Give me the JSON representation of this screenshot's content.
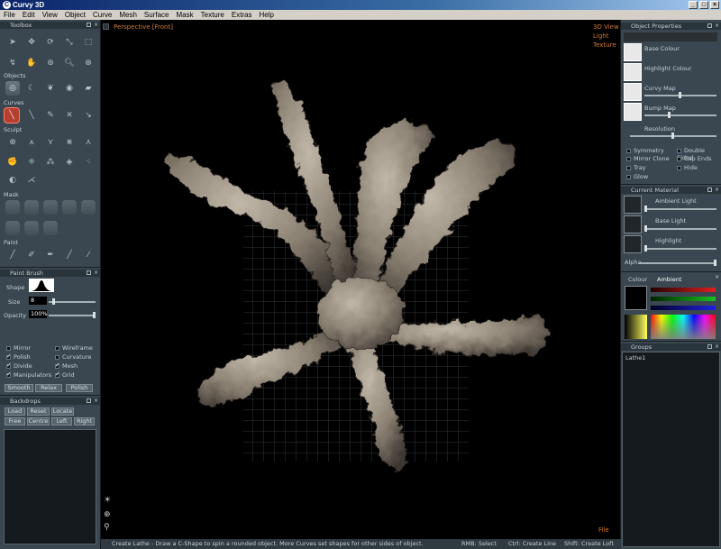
{
  "window": {
    "title": "Curvy 3D",
    "minimize": "_",
    "maximize": "□",
    "close": "×"
  },
  "menu": [
    "File",
    "Edit",
    "View",
    "Object",
    "Curve",
    "Mesh",
    "Surface",
    "Mask",
    "Texture",
    "Extras",
    "Help"
  ],
  "toolbox": {
    "title": "Toolbox",
    "objects_label": "Objects",
    "curves_label": "Curves",
    "sculpt_label": "Sculpt",
    "mask_label": "Mask",
    "paint_label": "Paint"
  },
  "paint_brush": {
    "title": "Paint Brush",
    "shape_label": "Shape",
    "size_label": "Size",
    "size_value": "8",
    "opacity_label": "Opacity",
    "opacity_value": "100%",
    "options": [
      {
        "label": "Mirror",
        "checked": false
      },
      {
        "label": "Wireframe",
        "checked": false
      },
      {
        "label": "Polish",
        "checked": true
      },
      {
        "label": "Curvature",
        "checked": false
      },
      {
        "label": "Divide",
        "checked": true
      },
      {
        "label": "Mesh",
        "checked": true
      },
      {
        "label": "Manipulators",
        "checked": true
      },
      {
        "label": "Grid",
        "checked": true
      }
    ],
    "buttons": [
      "Smooth",
      "Relax",
      "Polish"
    ]
  },
  "backdrops": {
    "title": "Backdrops",
    "buttons_row1": [
      "Load",
      "Reset",
      "Locate"
    ],
    "buttons_row2": [
      "Free",
      "Centre",
      "Left",
      "Right"
    ]
  },
  "viewport": {
    "view_label": "Perspective [Front]",
    "right_labels": [
      "3D View",
      "Light",
      "Texture"
    ],
    "file_label": "File"
  },
  "status": {
    "hint": "Create Lathe - Draw a C-Shape to spin a rounded object. More Curves set shapes for other sides of object.",
    "rmb": "RMB: Select",
    "ctrl": "Ctrl: Create Line",
    "shift": "Shift: Create Loft"
  },
  "object_properties": {
    "title": "Object Properties",
    "rows": [
      "Base Colour",
      "Highlight Colour",
      "Curvy Map",
      "Bump Map"
    ],
    "resolution_label": "Resolution",
    "options": [
      {
        "label": "Symmetry",
        "checked": false
      },
      {
        "label": "Double Sided",
        "checked": false
      },
      {
        "label": "Mirror Clone",
        "checked": false
      },
      {
        "label": "Cap Ends",
        "checked": false
      },
      {
        "label": "Tray",
        "checked": false
      },
      {
        "label": "Hide",
        "checked": false
      },
      {
        "label": "Glow",
        "checked": false
      }
    ]
  },
  "current_material": {
    "title": "Current Material",
    "rows": [
      "Ambient Light",
      "Base Light",
      "Highlight"
    ],
    "alpha_label": "Alpha"
  },
  "colour": {
    "tabs": [
      "Colour",
      "Ambient"
    ],
    "colors": {
      "red": "#e02020",
      "green": "#18c020",
      "blue": "#2020e0",
      "accent": "#d07a2a"
    }
  },
  "groups": {
    "title": "Groups",
    "items": [
      "Lathe1"
    ]
  }
}
